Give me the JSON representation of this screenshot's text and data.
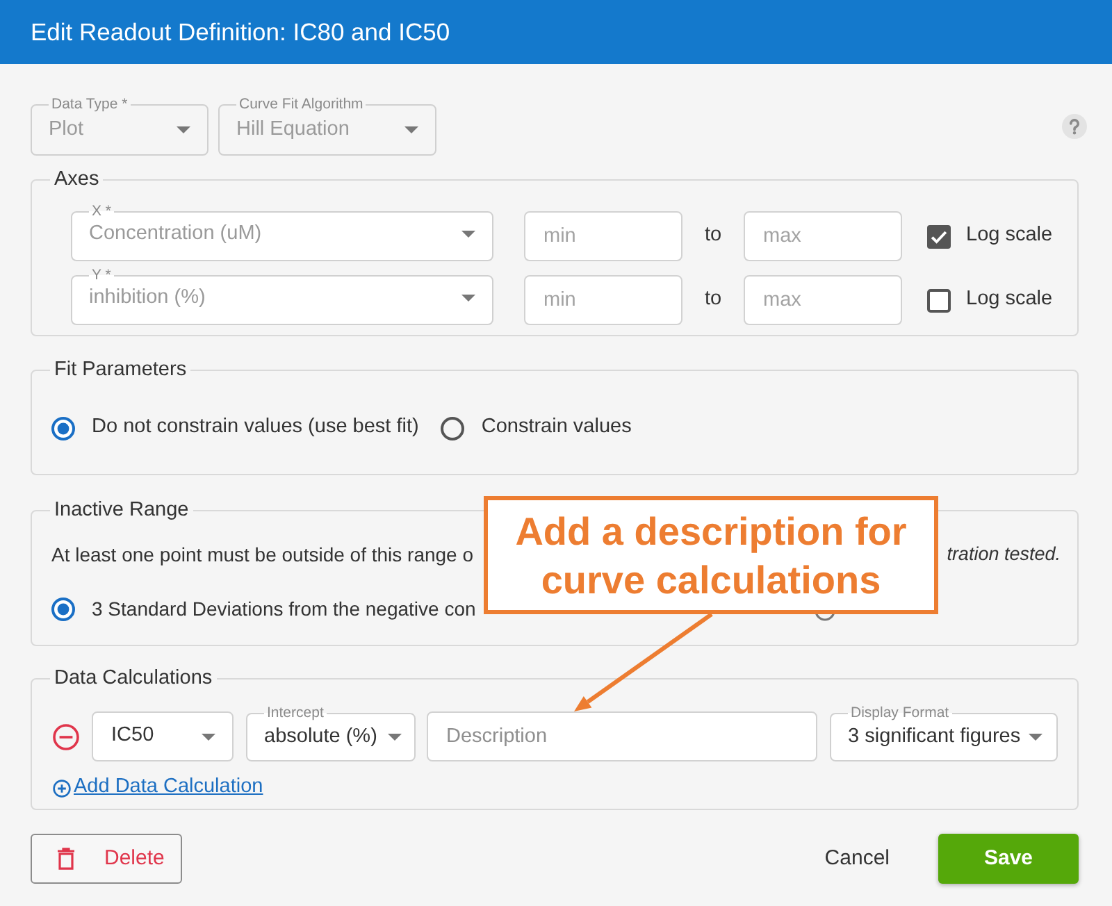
{
  "window": {
    "title": "Edit Readout Definition: IC80 and IC50"
  },
  "top_fields": [
    {
      "label": "Data Type *",
      "value": "Plot",
      "disabled": true
    },
    {
      "label": "Curve Fit Algorithm",
      "value": "Hill Equation",
      "disabled": true
    }
  ],
  "axes": {
    "title": "Axes",
    "rows": [
      {
        "axis_label": "X *",
        "value": "Concentration (uM)",
        "disabled": true,
        "min": {
          "placeholder": "min"
        },
        "separator": "to",
        "max": {
          "placeholder": "max"
        },
        "log_scale": {
          "label": "Log scale",
          "checked": true
        }
      },
      {
        "axis_label": "Y *",
        "value": "inhibition (%)",
        "disabled": true,
        "min": {
          "placeholder": "min"
        },
        "separator": "to",
        "max": {
          "placeholder": "max"
        },
        "log_scale": {
          "label": "Log scale",
          "checked": false
        }
      }
    ]
  },
  "fit_parameters": {
    "title": "Fit Parameters",
    "options": [
      {
        "label": "Do not constrain values (use best fit)",
        "selected": true
      },
      {
        "label": "Constrain values",
        "selected": false
      }
    ]
  },
  "inactive_range": {
    "title": "Inactive Range",
    "note_start": "At least one point must be outside of this range o",
    "note_end": "tration tested.",
    "options": [
      {
        "label": "3 Standard Deviations from the negative con",
        "selected": true
      }
    ]
  },
  "data_calculations": {
    "title": "Data Calculations",
    "rows": [
      {
        "calculation": "IC50",
        "intercept": {
          "label": "Intercept",
          "value": "absolute (%)"
        },
        "description": {
          "placeholder": "Description"
        },
        "display_format": {
          "label": "Display Format",
          "value": "3 significant figures"
        }
      }
    ],
    "add_link": "Add Data Calculation"
  },
  "footer": {
    "delete": "Delete",
    "cancel": "Cancel",
    "save": "Save"
  },
  "callout": {
    "text": "Add a description for curve calculations"
  }
}
